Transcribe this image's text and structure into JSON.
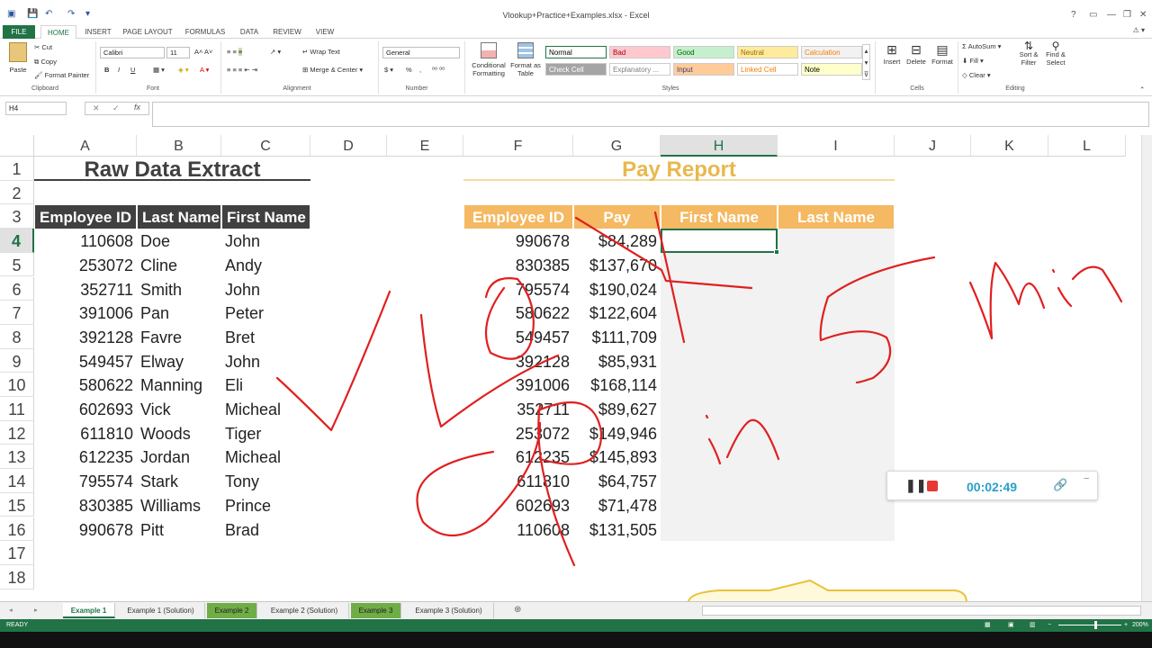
{
  "window": {
    "title": "Vlookup+Practice+Examples.xlsx - Excel",
    "controls": [
      "?",
      "▭",
      "—",
      "❐",
      "✕"
    ]
  },
  "tabs": [
    "FILE",
    "HOME",
    "INSERT",
    "PAGE LAYOUT",
    "FORMULAS",
    "DATA",
    "REVIEW",
    "VIEW"
  ],
  "ribbon": {
    "clipboard": {
      "paste": "Paste",
      "cut": "Cut",
      "copy": "Copy",
      "format_painter": "Format Painter",
      "label": "Clipboard"
    },
    "font": {
      "name": "Calibri",
      "size": "11",
      "bold": "B",
      "italic": "I",
      "underline": "U",
      "label": "Font"
    },
    "alignment": {
      "wrap": "Wrap Text",
      "merge": "Merge & Center",
      "label": "Alignment"
    },
    "number": {
      "format": "General",
      "currency": "$",
      "percent": "%",
      "comma": ",",
      "label": "Number"
    },
    "styles": {
      "conditional": "Conditional Formatting",
      "format_as_table": "Format as Table",
      "cells": [
        {
          "name": "Normal",
          "bg": "#ffffff",
          "fg": "#000000"
        },
        {
          "name": "Bad",
          "bg": "#ffc7ce",
          "fg": "#9c0006"
        },
        {
          "name": "Good",
          "bg": "#c6efce",
          "fg": "#006100"
        },
        {
          "name": "Neutral",
          "bg": "#ffeb9c",
          "fg": "#9c6500"
        },
        {
          "name": "Calculation",
          "bg": "#f2f2f2",
          "fg": "#fa7d00"
        },
        {
          "name": "Check Cell",
          "bg": "#a5a5a5",
          "fg": "#ffffff"
        },
        {
          "name": "Explanatory ...",
          "bg": "#ffffff",
          "fg": "#7f7f7f"
        },
        {
          "name": "Input",
          "bg": "#ffcc99",
          "fg": "#3f3f76"
        },
        {
          "name": "Linked Cell",
          "bg": "#ffffff",
          "fg": "#fa7d00"
        },
        {
          "name": "Note",
          "bg": "#ffffcc",
          "fg": "#000000"
        }
      ],
      "label": "Styles"
    },
    "cells": {
      "insert": "Insert",
      "delete": "Delete",
      "format": "Format",
      "label": "Cells"
    },
    "editing": {
      "autosum": "AutoSum",
      "fill": "Fill",
      "clear": "Clear",
      "sort": "Sort & Filter",
      "find": "Find & Select",
      "label": "Editing"
    }
  },
  "formula_bar": {
    "name_box": "H4",
    "formula": ""
  },
  "columns": [
    "A",
    "B",
    "C",
    "D",
    "E",
    "F",
    "G",
    "H",
    "I",
    "J",
    "K",
    "L"
  ],
  "rows": [
    "1",
    "2",
    "3",
    "4",
    "5",
    "6",
    "7",
    "8",
    "9",
    "10",
    "11",
    "12",
    "13",
    "14",
    "15",
    "16",
    "17",
    "18"
  ],
  "raw_data": {
    "title": "Raw Data Extract",
    "headers": [
      "Employee ID",
      "Last Name",
      "First Name"
    ],
    "records": [
      [
        "110608",
        "Doe",
        "John"
      ],
      [
        "253072",
        "Cline",
        "Andy"
      ],
      [
        "352711",
        "Smith",
        "John"
      ],
      [
        "391006",
        "Pan",
        "Peter"
      ],
      [
        "392128",
        "Favre",
        "Bret"
      ],
      [
        "549457",
        "Elway",
        "John"
      ],
      [
        "580622",
        "Manning",
        "Eli"
      ],
      [
        "602693",
        "Vick",
        "Micheal"
      ],
      [
        "611810",
        "Woods",
        "Tiger"
      ],
      [
        "612235",
        "Jordan",
        "Micheal"
      ],
      [
        "795574",
        "Stark",
        "Tony"
      ],
      [
        "830385",
        "Williams",
        "Prince"
      ],
      [
        "990678",
        "Pitt",
        "Brad"
      ]
    ]
  },
  "pay_report": {
    "title": "Pay Report",
    "headers": [
      "Employee ID",
      "Pay",
      "First Name",
      "Last Name"
    ],
    "records": [
      [
        "990678",
        "$84,289"
      ],
      [
        "830385",
        "$137,670"
      ],
      [
        "795574",
        "$190,024"
      ],
      [
        "580622",
        "$122,604"
      ],
      [
        "549457",
        "$111,709"
      ],
      [
        "392128",
        "$85,931"
      ],
      [
        "391006",
        "$168,114"
      ],
      [
        "352711",
        "$89,627"
      ],
      [
        "253072",
        "$149,946"
      ],
      [
        "612235",
        "$145,893"
      ],
      [
        "611810",
        "$64,757"
      ],
      [
        "602693",
        "$71,478"
      ],
      [
        "110608",
        "$131,505"
      ]
    ]
  },
  "sheets": [
    {
      "name": "Example 1",
      "state": "active"
    },
    {
      "name": "Example 1 (Solution)",
      "state": "normal"
    },
    {
      "name": "Example 2",
      "state": "green"
    },
    {
      "name": "Example 2 (Solution)",
      "state": "normal"
    },
    {
      "name": "Example 3",
      "state": "green"
    },
    {
      "name": "Example 3 (Solution)",
      "state": "normal"
    }
  ],
  "status": {
    "ready": "READY",
    "zoom": "200%"
  },
  "recorder": {
    "time": "00:02:49"
  },
  "colors": {
    "dark_header": "#404040",
    "gold_header": "#f4b962",
    "gold_title": "#e8b84e",
    "excel_green": "#217346",
    "ink": "#e02020"
  }
}
